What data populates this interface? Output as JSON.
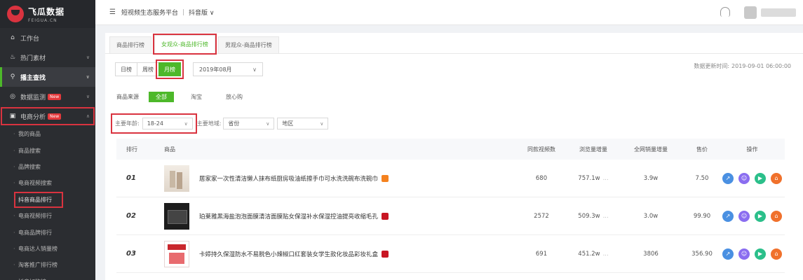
{
  "brand": {
    "name": "飞瓜数据",
    "sub": "FEIGUA.CN",
    "colors": {
      "accent_green": "#4db82a",
      "highlight_red": "#d9333f",
      "sidebar_bg": "#2b2d31"
    }
  },
  "sidebar": {
    "items": [
      {
        "label": "工作台",
        "icon": "home-icon"
      },
      {
        "label": "热门素材",
        "icon": "fire-icon"
      },
      {
        "label": "播主查找",
        "icon": "search-icon"
      },
      {
        "label": "数据监测",
        "icon": "monitor-icon",
        "badge": "New"
      },
      {
        "label": "电商分析",
        "icon": "bag-icon",
        "badge": "New"
      }
    ],
    "sub_items": [
      "我的商品",
      "商品搜索",
      "品牌搜索",
      "电商视频搜索",
      "抖音商品排行",
      "电商视频排行",
      "电商品牌排行",
      "电商达人销量榜",
      "淘客推广排行榜",
      "抖音好物榜"
    ]
  },
  "topbar": {
    "platform": "短视频生态服务平台",
    "sep": "|",
    "version": "抖音版"
  },
  "tabs": [
    "商品排行榜",
    "女观众-商品排行榜",
    "男观众-商品排行榜"
  ],
  "period": {
    "buttons": [
      "日榜",
      "周榜",
      "月榜"
    ],
    "month": "2019年08月"
  },
  "update": {
    "label": "数据更新时间:",
    "value": "2019-09-01 06:00:00"
  },
  "source": {
    "label": "商品来源",
    "options": [
      "全部",
      "淘宝",
      "放心购"
    ]
  },
  "filters": {
    "age_label": "主要年龄:",
    "age_value": "18-24",
    "region_label": "主要地域:",
    "province_placeholder": "省份",
    "city_placeholder": "地区"
  },
  "table": {
    "headers": [
      "排行",
      "商品",
      "同款视频数",
      "浏览量增量",
      "全网销量增量",
      "售价",
      "操作"
    ],
    "rows": [
      {
        "rank": "01",
        "name": "居家家一次性清洁懒人抹布纸厨房吸油纸擦手巾可水洗洗碗布洗碗巾",
        "videos": "680",
        "browse": "757.1w",
        "sales": "3.9w",
        "price": "7.50",
        "shop_icon": "tmall-icon"
      },
      {
        "rank": "02",
        "name": "珀莱雅黑海盐泡泡面膜清洁面膜贴女保湿补水保湿控油提亮收缩毛孔",
        "videos": "2572",
        "browse": "509.3w",
        "sales": "3.0w",
        "price": "99.90",
        "shop_icon": "jd-icon"
      },
      {
        "rank": "03",
        "name": "卡婷持久保湿防水不易脱色小辣椒口红套装女学生款化妆品彩妆礼盒",
        "videos": "691",
        "browse": "451.2w",
        "sales": "3806",
        "price": "356.90",
        "shop_icon": "jd-icon"
      }
    ],
    "dash": "..."
  }
}
